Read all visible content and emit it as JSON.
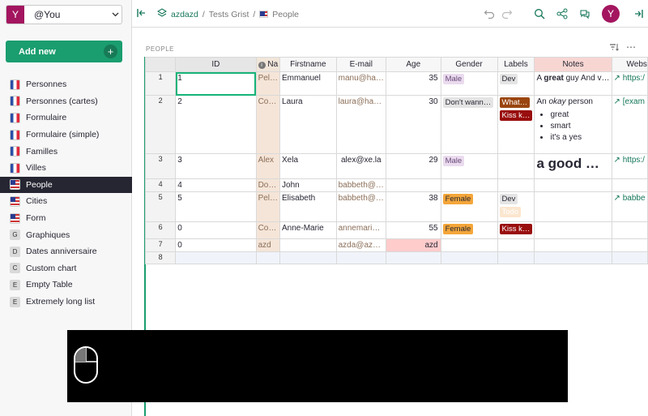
{
  "org": {
    "avatar": "Y",
    "name": "@You"
  },
  "add_new": {
    "label": "Add new"
  },
  "pages": [
    {
      "icon": "flag-fr",
      "label": "Personnes"
    },
    {
      "icon": "flag-fr",
      "label": "Personnes (cartes)"
    },
    {
      "icon": "flag-fr",
      "label": "Formulaire"
    },
    {
      "icon": "flag-fr",
      "label": "Formulaire (simple)"
    },
    {
      "icon": "flag-fr",
      "label": "Familles"
    },
    {
      "icon": "flag-fr",
      "label": "Villes"
    },
    {
      "icon": "flag-us",
      "label": "People",
      "active": true
    },
    {
      "icon": "flag-us",
      "label": "Cities"
    },
    {
      "icon": "flag-us",
      "label": "Form"
    },
    {
      "icon": "G",
      "label": "Graphiques"
    },
    {
      "icon": "D",
      "label": "Dates anniversaire"
    },
    {
      "icon": "C",
      "label": "Custom chart"
    },
    {
      "icon": "E",
      "label": "Empty Table"
    },
    {
      "icon": "E",
      "label": "Extremely long list"
    }
  ],
  "breadcrumb": {
    "doc": "azdazd",
    "workspace": "Tests Grist",
    "page": "People"
  },
  "user_avatar": "Y",
  "section": {
    "title": "PEOPLE"
  },
  "columns": {
    "id": "ID",
    "name": "Na",
    "firstname": "Firstname",
    "email": "E-mail",
    "age": "Age",
    "gender": "Gender",
    "labels": "Labels",
    "notes": "Notes",
    "website": "Webs"
  },
  "rows": [
    {
      "n": "1",
      "id": "1",
      "name": "Pel…",
      "first": "Emmanuel",
      "email": "manu@ha…",
      "age": "35",
      "gender": "Male",
      "labels": [
        "Dev"
      ],
      "notes_pre": "A ",
      "notes_bold": "great",
      "notes_post": " guy And v…",
      "web": "https:/"
    },
    {
      "n": "2",
      "id": "2",
      "name": "Co…",
      "first": "Laura",
      "email": "laura@ha…",
      "age": "30",
      "gender": "Don't wann…",
      "labels": [
        "What…",
        "Kiss k…"
      ],
      "notes_pre": "An ",
      "notes_em": "okay",
      "notes_post": " person",
      "notes_list": [
        "great",
        "smart",
        "it's a yes"
      ],
      "web": "[exam"
    },
    {
      "n": "3",
      "id": "3",
      "name": "Alex",
      "first": "Xela",
      "email": "alex@xe.la",
      "age": "29",
      "gender": "Male",
      "labels": [],
      "notes_big": "a good …",
      "web": "https:/"
    },
    {
      "n": "4",
      "id": "4",
      "name": "Do…",
      "first": "John",
      "email": "babbeth@…",
      "age": "",
      "gender": "",
      "labels": [],
      "web": ""
    },
    {
      "n": "5",
      "id": "5",
      "name": "Pel…",
      "first": "Elisabeth",
      "email": "babbeth@…",
      "age": "38",
      "gender": "Female",
      "labels": [
        "Dev",
        "Todo"
      ],
      "web": "babbe"
    },
    {
      "n": "6",
      "id": "0",
      "name": "Co…",
      "first": "Anne-Marie",
      "email": "annemari…",
      "age": "55",
      "gender": "Female",
      "labels": [
        "Kiss k…"
      ],
      "web": ""
    },
    {
      "n": "7",
      "id": "0",
      "name": "azd",
      "first": "",
      "email": "azda@az…",
      "age": "azd",
      "gender": "",
      "labels": [],
      "web": ""
    },
    {
      "n": "8",
      "id": "",
      "name": "",
      "first": "",
      "email": "",
      "age": "",
      "gender": "",
      "labels": [],
      "web": ""
    }
  ]
}
